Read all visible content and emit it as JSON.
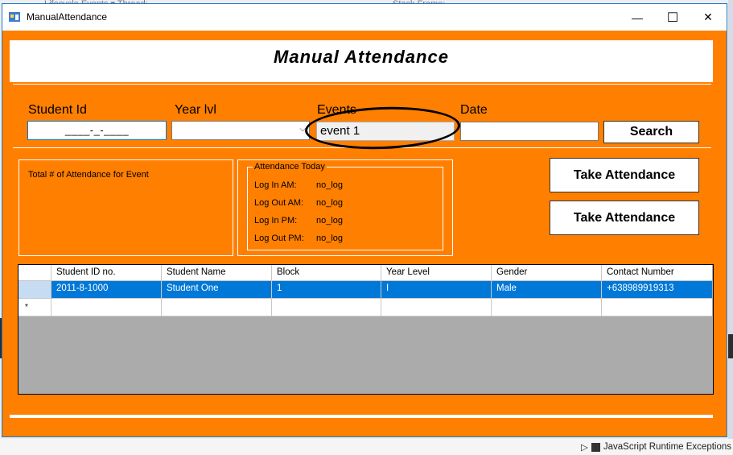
{
  "background": {
    "ide_tabs": [
      "Lifecycle Events",
      "Thread:",
      "Stack Frame:"
    ],
    "tree_item": "JavaScript Runtime Exceptions"
  },
  "window": {
    "title": "ManualAttendance",
    "minimize": "—",
    "maximize": "☐",
    "close": "✕"
  },
  "form": {
    "heading": "Manual Attendance",
    "labels": {
      "student_id": "Student Id",
      "year": "Year lvl",
      "events": "Events",
      "date": "Date"
    },
    "student_id_value": "____-_-____",
    "year_value": "",
    "event_value": "event 1",
    "date_value": "",
    "search_button": "Search",
    "total_label": "Total # of Attendance for Event",
    "attendance_today": {
      "legend": "Attendance Today",
      "rows": [
        {
          "label": "Log In AM:",
          "value": "no_log"
        },
        {
          "label": "Log Out AM:",
          "value": "no_log"
        },
        {
          "label": "Log In PM:",
          "value": "no_log"
        },
        {
          "label": "Log Out PM:",
          "value": "no_log"
        }
      ]
    },
    "take_attendance_1": "Take Attendance",
    "take_attendance_2": "Take Attendance"
  },
  "grid": {
    "columns": [
      "Student ID no.",
      "Student Name",
      "Block",
      "Year Level",
      "Gender",
      "Contact Number"
    ],
    "rows": [
      [
        "2011-8-1000",
        "Student One",
        "1",
        "I",
        "Male",
        "+638989919313"
      ]
    ],
    "new_row_marker": "*"
  },
  "colors": {
    "accent": "#ff7f00",
    "selection": "#0078d7"
  }
}
